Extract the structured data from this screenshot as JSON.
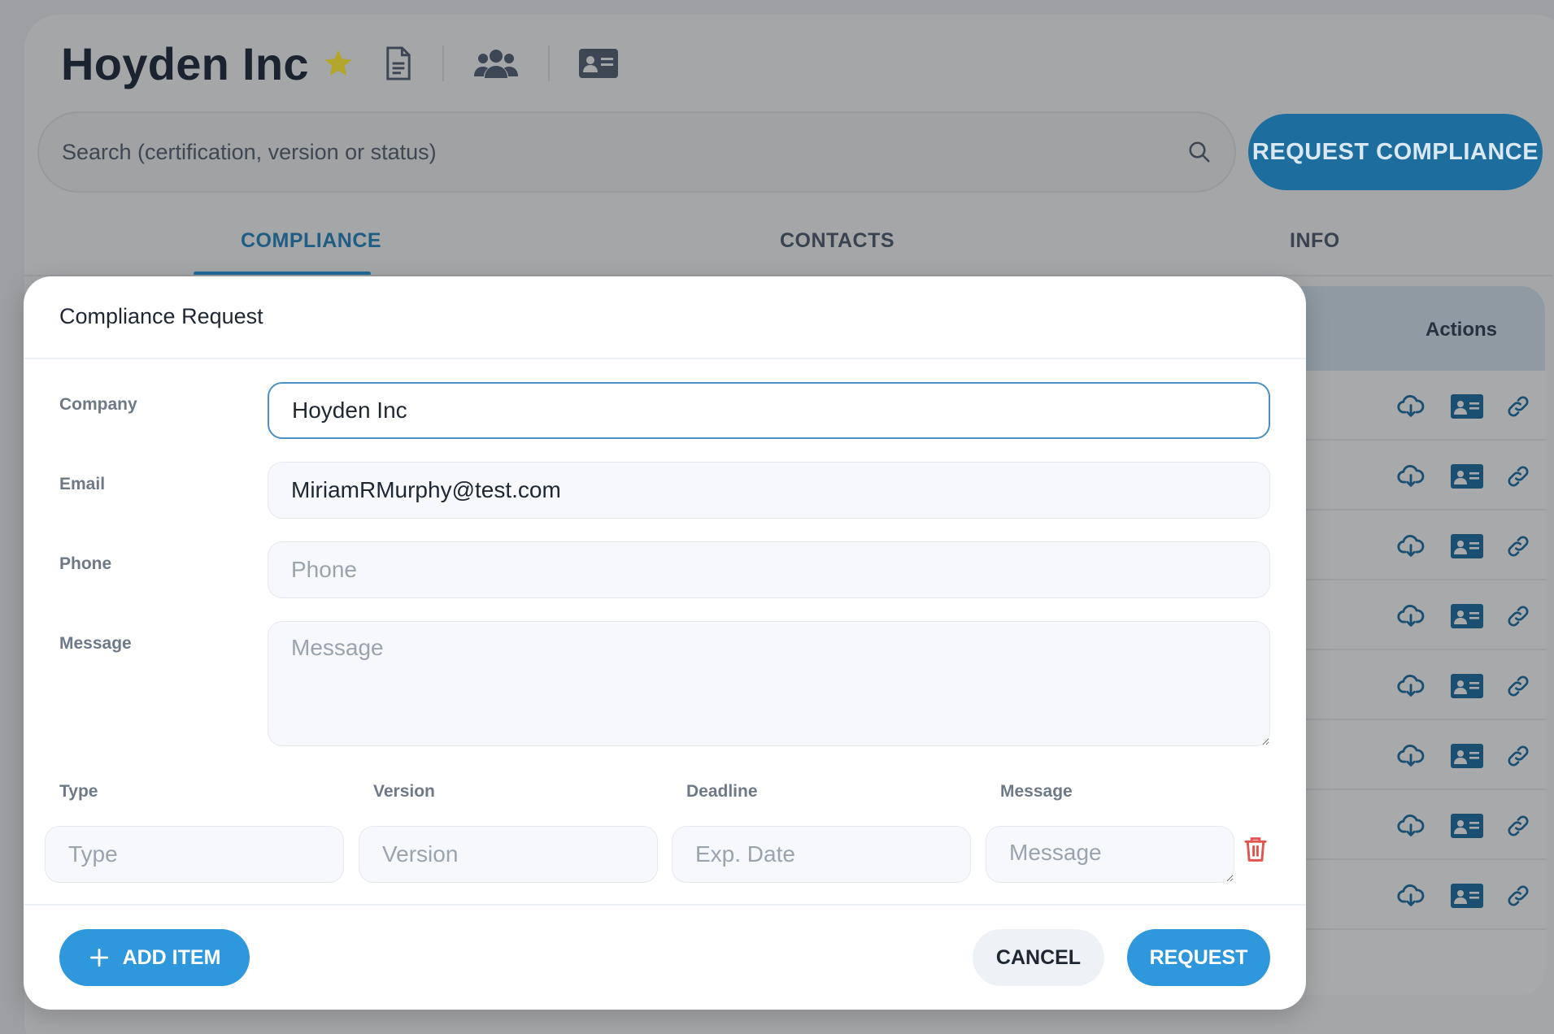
{
  "header": {
    "company_name": "Hoyden Inc",
    "icons": [
      "star-icon",
      "document-icon",
      "users-icon",
      "id-card-icon"
    ]
  },
  "search": {
    "placeholder": "Search (certification, version or status)"
  },
  "request_compliance_label": "REQUEST COMPLIANCE",
  "tabs": [
    {
      "label": "COMPLIANCE",
      "active": true
    },
    {
      "label": "CONTACTS",
      "active": false
    },
    {
      "label": "INFO",
      "active": false
    }
  ],
  "table": {
    "actions_header": "Actions",
    "row_actions": [
      "download-icon",
      "contact-card-icon",
      "link-icon"
    ],
    "row_count": 8
  },
  "modal": {
    "title": "Compliance Request",
    "fields": {
      "company": {
        "label": "Company",
        "value": "Hoyden Inc"
      },
      "email": {
        "label": "Email",
        "value": "MiriamRMurphy@test.com"
      },
      "phone": {
        "label": "Phone",
        "value": "",
        "placeholder": "Phone"
      },
      "message": {
        "label": "Message",
        "value": "",
        "placeholder": "Message"
      }
    },
    "item_columns": {
      "type": "Type",
      "version": "Version",
      "deadline": "Deadline",
      "message": "Message"
    },
    "item_placeholders": {
      "type": "Type",
      "version": "Version",
      "deadline": "Exp. Date",
      "message": "Message"
    },
    "buttons": {
      "add_item": "ADD ITEM",
      "cancel": "CANCEL",
      "request": "REQUEST"
    }
  },
  "colors": {
    "primary": "#2f97db",
    "overlay_button": "#1d6e9e",
    "delete": "#e0564f",
    "star": "#b5a82a"
  }
}
